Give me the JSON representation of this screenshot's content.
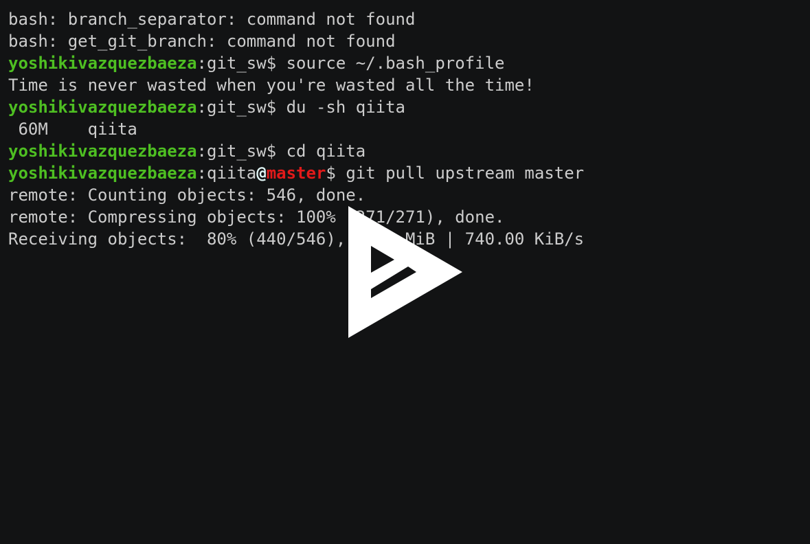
{
  "terminal": {
    "background": "#121314",
    "colors": {
      "text": "#cccccc",
      "user": "#4ebf22",
      "at": "#e0f4f4",
      "branch": "#e11a1a"
    },
    "lines": {
      "l1": "bash: branch_separator: command not found",
      "l2": "bash: get_git_branch: command not found",
      "l3": {
        "user": "yoshikivazquezbaeza",
        "dir": ":git_sw$ ",
        "cmd": "source ~/.bash_profile"
      },
      "l4": "Time is never wasted when you're wasted all the time!",
      "l5": {
        "user": "yoshikivazquezbaeza",
        "dir": ":git_sw$ ",
        "cmd": "du -sh qiita"
      },
      "l6": " 60M    qiita",
      "l7": {
        "user": "yoshikivazquezbaeza",
        "dir": ":git_sw$ ",
        "cmd": "cd qiita"
      },
      "l8": {
        "user": "yoshikivazquezbaeza",
        "dir": ":qiita",
        "at": "@",
        "branch": "master",
        "prompt": "$ ",
        "cmd": "git pull upstream master"
      },
      "l9": "remote: Counting objects: 546, done.",
      "l10": "remote: Compressing objects: 100% (271/271), done.",
      "l11": "Receiving objects:  80% (440/546), 8.24 MiB | 740.00 KiB/s"
    }
  },
  "overlay": {
    "icon": "asciinema-play-icon"
  }
}
